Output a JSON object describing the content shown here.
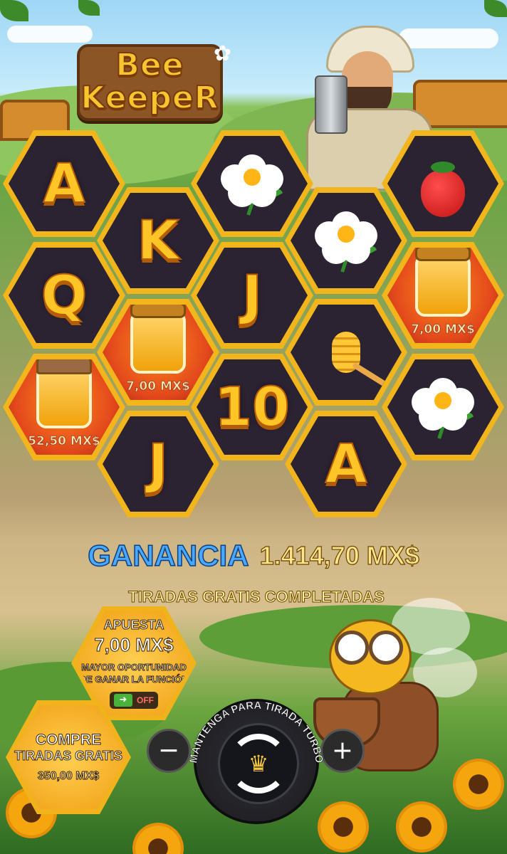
{
  "game": {
    "logo_line1": "Bee",
    "logo_line2": "KeepeR"
  },
  "reels": [
    {
      "id": "r1c1",
      "symbol": "A",
      "type": "letter"
    },
    {
      "id": "r1c2",
      "symbol": "K",
      "type": "letter"
    },
    {
      "id": "r1c3",
      "symbol": "daisy",
      "type": "flower"
    },
    {
      "id": "r1c4",
      "symbol": "daisy",
      "type": "flower"
    },
    {
      "id": "r1c5",
      "symbol": "strawberry",
      "type": "fruit"
    },
    {
      "id": "r2c1",
      "symbol": "Q",
      "type": "letter"
    },
    {
      "id": "r2c2",
      "symbol": "honey-jar",
      "type": "bonus",
      "value": "7,00 MX$"
    },
    {
      "id": "r2c3",
      "symbol": "J",
      "type": "letter"
    },
    {
      "id": "r2c4",
      "symbol": "honey-dipper",
      "type": "item"
    },
    {
      "id": "r2c5",
      "symbol": "honey-jar",
      "type": "bonus",
      "value": "7,00 MX$"
    },
    {
      "id": "r3c1",
      "symbol": "honey-pot-cloth",
      "type": "bonus",
      "value": "52,50 MX$"
    },
    {
      "id": "r3c2",
      "symbol": "J",
      "type": "letter"
    },
    {
      "id": "r3c3",
      "symbol": "10",
      "type": "letter"
    },
    {
      "id": "r3c4",
      "symbol": "A",
      "type": "letter"
    },
    {
      "id": "r3c5",
      "symbol": "daisy",
      "type": "flower"
    }
  ],
  "win": {
    "label": "GANANCIA",
    "amount": "1.414,70 MX$",
    "status": "TIRADAS GRATIS COMPLETADAS"
  },
  "bet": {
    "label": "APUESTA",
    "value": "7,00 MX$",
    "feature_text_1": "MAYOR OPORTUNIDAD",
    "feature_text_2": "DE GANAR LA FUNCIÓN",
    "toggle_state": "OFF"
  },
  "buy": {
    "line1": "COMPRE",
    "line2": "TIRADAS GRATIS",
    "price": "350,00 MX$"
  },
  "controls": {
    "minus": "−",
    "plus": "+",
    "turbo_text": "MANTENGA PARA TIRADA TURBO"
  },
  "colors": {
    "win_label": "#4aa8ff",
    "gold_frame": "#f2b51c",
    "reel_dark": "#2b2232",
    "bonus_orange": "#e2471c"
  }
}
